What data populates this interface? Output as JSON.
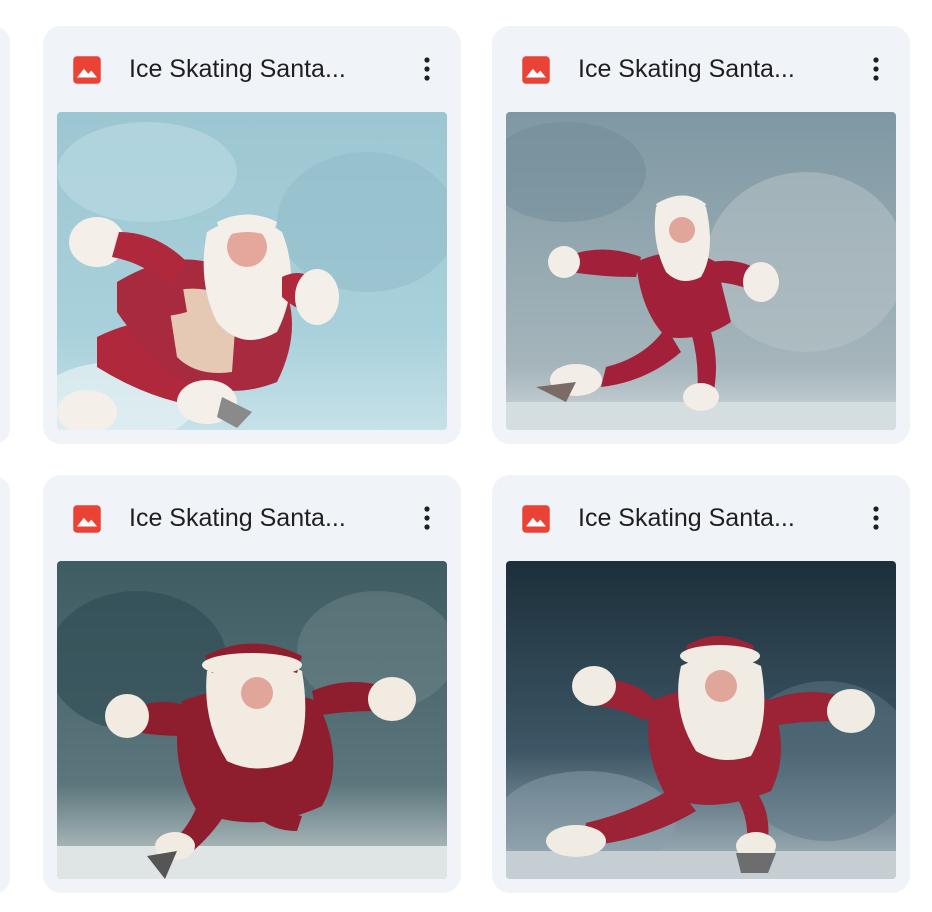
{
  "files": [
    {
      "title": "Ice Skating Santa...",
      "type_icon": "image-file-icon",
      "menu_icon": "more-vert-icon",
      "scene": "light-blue"
    },
    {
      "title": "Ice Skating Santa...",
      "type_icon": "image-file-icon",
      "menu_icon": "more-vert-icon",
      "scene": "gray-blue"
    },
    {
      "title": "Ice Skating Santa...",
      "type_icon": "image-file-icon",
      "menu_icon": "more-vert-icon",
      "scene": "teal-dark"
    },
    {
      "title": "Ice Skating Santa...",
      "type_icon": "image-file-icon",
      "menu_icon": "more-vert-icon",
      "scene": "navy-dark"
    }
  ],
  "colors": {
    "card_bg": "#f0f4f9",
    "icon_red": "#ea4335",
    "text": "#1f1f1f",
    "santa_red": "#b0283c",
    "fur": "#f4efe8"
  }
}
